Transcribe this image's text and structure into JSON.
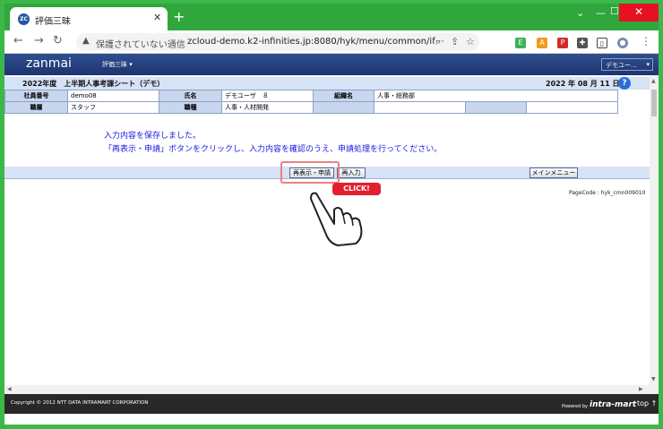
{
  "browser": {
    "tab_title": "評価三昧",
    "tab_favicon_text": "ZC",
    "security_text": "保護されていない通信",
    "url": "zcloud-demo.k2-infinities.jp:8080/hyk/menu/common/if⋯"
  },
  "app": {
    "logo": "zanmai",
    "menu": "評価三昧 ▾",
    "user": "デモユー...",
    "sheet_title": "2022年度　上半期人事考課シート（デモ）",
    "date": "2022 年 08 月 11 日",
    "help": "?"
  },
  "info": {
    "row1": [
      {
        "label": "社員番号",
        "value": "demo08"
      },
      {
        "label": "氏名",
        "value": "デモユーザ　８"
      },
      {
        "label": "組織名",
        "value": "人事・総務部"
      }
    ],
    "row2": [
      {
        "label": "職層",
        "value": "スタッフ"
      },
      {
        "label": "職種",
        "value": "人事・人材開発"
      }
    ]
  },
  "messages": {
    "line1": "入力内容を保存しました。",
    "line2": "「再表示・申請」ボタンをクリックし、入力内容を確認のうえ、申請処理を行ってください。"
  },
  "actions": {
    "redisplay": "再表示・申請",
    "reinput": "再入力",
    "main_menu": "メインメニュー"
  },
  "page_code": "PageCode : hyk_cmn009010",
  "click_label": "CLICK!",
  "footer": {
    "copyright": "Copyright © 2012 NTT DATA INTRAMART CORPORATION",
    "powered": "Powered by",
    "brand": "intra-mart",
    "top": "top ↑"
  },
  "colors": {
    "frame": "#3cb84a",
    "header": "#1d3470",
    "message": "#1a1adf",
    "highlight": "#f07f80",
    "click_badge": "#e41e2e"
  }
}
